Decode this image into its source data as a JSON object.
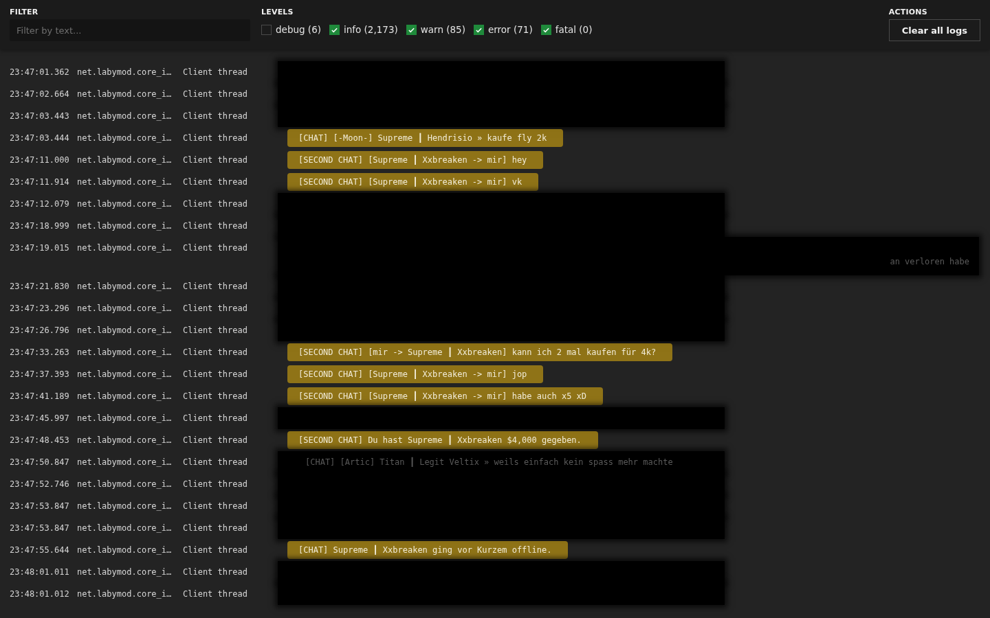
{
  "filter": {
    "label": "FILTER",
    "placeholder": "Filter by text..."
  },
  "levels": {
    "label": "LEVELS",
    "items": [
      {
        "label": "debug (6)",
        "checked": false
      },
      {
        "label": "info (2,173)",
        "checked": true
      },
      {
        "label": "warn (85)",
        "checked": true
      },
      {
        "label": "error (71)",
        "checked": true
      },
      {
        "label": "fatal (0)",
        "checked": true
      }
    ]
  },
  "actions": {
    "label": "ACTIONS",
    "button": "Clear all logs"
  },
  "rows": [
    {
      "time": "23:47:01.362",
      "module": "net.labymod.core_i…",
      "thread": "Client thread",
      "kind": "redacted"
    },
    {
      "time": "23:47:02.664",
      "module": "net.labymod.core_i…",
      "thread": "Client thread",
      "kind": "redacted"
    },
    {
      "time": "23:47:03.443",
      "module": "net.labymod.core_i…",
      "thread": "Client thread",
      "kind": "redacted"
    },
    {
      "time": "23:47:03.444",
      "module": "net.labymod.core_i…",
      "thread": "Client thread",
      "kind": "highlight",
      "message": "[CHAT] [-Moon-] Supreme ┃ Hendrisio » kaufe fly 2k"
    },
    {
      "time": "23:47:11.000",
      "module": "net.labymod.core_i…",
      "thread": "Client thread",
      "kind": "highlight",
      "message": "[SECOND CHAT] [Supreme ┃ Xxbreaken -> mir] hey"
    },
    {
      "time": "23:47:11.914",
      "module": "net.labymod.core_i…",
      "thread": "Client thread",
      "kind": "highlight",
      "message": "[SECOND CHAT] [Supreme ┃ Xxbreaken -> mir] vk"
    },
    {
      "time": "23:47:12.079",
      "module": "net.labymod.core_i…",
      "thread": "Client thread",
      "kind": "redacted"
    },
    {
      "time": "23:47:18.999",
      "module": "net.labymod.core_i…",
      "thread": "Client thread",
      "kind": "redacted"
    },
    {
      "time": "23:47:19.015",
      "module": "net.labymod.core_i…",
      "thread": "Client thread",
      "kind": "redacted",
      "tall": true,
      "message": "an verloren habe"
    },
    {
      "time": "23:47:21.830",
      "module": "net.labymod.core_i…",
      "thread": "Client thread",
      "kind": "redacted"
    },
    {
      "time": "23:47:23.296",
      "module": "net.labymod.core_i…",
      "thread": "Client thread",
      "kind": "redacted"
    },
    {
      "time": "23:47:26.796",
      "module": "net.labymod.core_i…",
      "thread": "Client thread",
      "kind": "redacted"
    },
    {
      "time": "23:47:33.263",
      "module": "net.labymod.core_i…",
      "thread": "Client thread",
      "kind": "highlight",
      "message": "[SECOND CHAT] [mir -> Supreme ┃ Xxbreaken] kann ich 2 mal kaufen für 4k?"
    },
    {
      "time": "23:47:37.393",
      "module": "net.labymod.core_i…",
      "thread": "Client thread",
      "kind": "highlight",
      "message": "[SECOND CHAT] [Supreme ┃ Xxbreaken -> mir] jop"
    },
    {
      "time": "23:47:41.189",
      "module": "net.labymod.core_i…",
      "thread": "Client thread",
      "kind": "highlight",
      "message": "[SECOND CHAT] [Supreme ┃ Xxbreaken -> mir] habe auch x5 xD"
    },
    {
      "time": "23:47:45.997",
      "module": "net.labymod.core_i…",
      "thread": "Client thread",
      "kind": "redacted"
    },
    {
      "time": "23:47:48.453",
      "module": "net.labymod.core_i…",
      "thread": "Client thread",
      "kind": "highlight",
      "message": "[SECOND CHAT] Du hast Supreme ┃ Xxbreaken $4,000 gegeben."
    },
    {
      "time": "23:47:50.847",
      "module": "net.labymod.core_i…",
      "thread": "Client thread",
      "kind": "redacted",
      "message": "[CHAT] [Artic] Titan ┃ Legit Veltix » weils einfach kein spass mehr machte"
    },
    {
      "time": "23:47:52.746",
      "module": "net.labymod.core_i…",
      "thread": "Client thread",
      "kind": "redacted"
    },
    {
      "time": "23:47:53.847",
      "module": "net.labymod.core_i…",
      "thread": "Client thread",
      "kind": "redacted"
    },
    {
      "time": "23:47:53.847",
      "module": "net.labymod.core_i…",
      "thread": "Client thread",
      "kind": "redacted"
    },
    {
      "time": "23:47:55.644",
      "module": "net.labymod.core_i…",
      "thread": "Client thread",
      "kind": "highlight",
      "message": "[CHAT] Supreme ┃ Xxbreaken ging vor Kurzem offline."
    },
    {
      "time": "23:48:01.011",
      "module": "net.labymod.core_i…",
      "thread": "Client thread",
      "kind": "redacted"
    },
    {
      "time": "23:48:01.012",
      "module": "net.labymod.core_i…",
      "thread": "Client thread",
      "kind": "redacted"
    }
  ]
}
